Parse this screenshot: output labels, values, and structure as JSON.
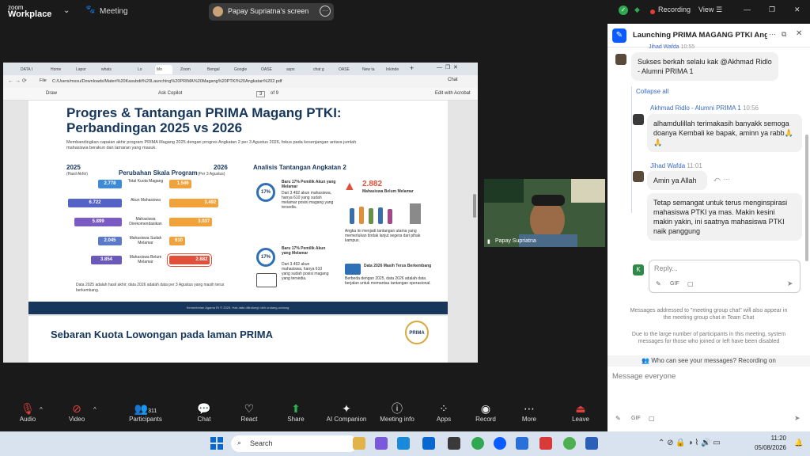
{
  "top": {
    "app_line1": "zoom",
    "app_line2": "Workplace",
    "meeting_label": "Meeting",
    "share_label": "Papay Supriatna's screen",
    "recording_label": "Recording",
    "view_label": "View"
  },
  "browser": {
    "tabs": [
      "DATA I",
      "Home",
      "Lapor",
      "whats",
      "Lo",
      "Mo",
      "Zoom",
      "Bengal",
      "Google",
      "OASE",
      "aspx",
      "chat g",
      "OASE",
      "New ta",
      "Inkinde"
    ],
    "url_prefix": "File",
    "url": "C:/Users/mssu/Downloads/Materi%20Kasubdit%20Launching%20PRIMA%20Magang%20PTKI%20Angkatan%202.pdf",
    "chat_btn": "Chat",
    "draw": "Draw",
    "ask_copilot": "Ask Copilot",
    "page_num": "3",
    "page_of": "of 9",
    "edit_acrobat": "Edit with Acrobat"
  },
  "slide": {
    "title": "Progres & Tantangan PRIMA Magang PTKI: Perbandingan 2025 vs 2026",
    "subtitle": "Membandingkan capaian akhir program PRIMA Magang 2025 dengan progres Angkatan 2 per 3 Agustus 2026, fokus pada kesenjangan antara jumlah mahasiswa berakun dan lamaran yang masuk.",
    "left_year": "2025",
    "left_year_sub": "(Hasil Akhir)",
    "center_heading": "Perubahan Skala Program",
    "right_year": "2026",
    "right_year_sub": "(Per 3 Agustus)",
    "rows": [
      {
        "label": "Total Kuota Magang",
        "v2025": "2.778",
        "v2026": "1.546"
      },
      {
        "label": "Akun Mahasiswa",
        "v2025": "6.722",
        "v2026": "3.492"
      },
      {
        "label": "Mahasiswa Direkomendasikan",
        "v2025": "5.899",
        "v2026": "3.037"
      },
      {
        "label": "Mahasiswa Sudah Melamar",
        "v2025": "2.045",
        "v2026": "610"
      },
      {
        "label": "Mahasiswa Belum Melamar",
        "v2025": "3.854",
        "v2026": "2.882"
      }
    ],
    "left_note": "Data 2025 adalah hasil akhir; data 2026 adalah data per 3 Agustus yang masih terus berkembang.",
    "analysis_heading": "Analisis Tantangan Angkatan 2",
    "a1_pct": "17%",
    "a1_title": "Baru 17% Pemilik Akun yang Melamar",
    "a1_text": "Dari 3.492 akun mahasiswa, hanya 610 yang sudah melamar posisi magang yang tersedia.",
    "a2_num": "2.882",
    "a2_title": "Mahasiswa Belum Melamar",
    "a2_text": "Angka ini menjadi tantangan utama yang memerlukan tindak lanjut segera dari pihak kampus.",
    "a3_pct": "17%",
    "a3_title": "Baru 17% Pemilik Akun yang Melamar",
    "a3_text": "Dari 3.492 akun mahasiswa, hanya 610 yang sudah posisi magang yang tersedia.",
    "a4_title": "Data 2026 Masih Terus Berkembang",
    "a4_text": "Berbeda dengan 2025, data 2026 adalah data berjalan untuk memantau tantangan operasional.",
    "footer": "Kementerian Agama RI © 2025. Hak data dilindungi oleh undang-undang.",
    "next_title": "Sebaran Kuota Lowongan pada laman PRIMA",
    "logo_text": "PRIMA"
  },
  "video": {
    "name": "Papay Supriatna"
  },
  "chat": {
    "title": "Launching PRIMA MAGANG PTKI Angk...",
    "partial_sender": "Jihad Wafda",
    "partial_time": "10:55",
    "m1": "Sukses berkah selalu kak @Akhmad Ridlo - Alumni PRIMA 1",
    "collapse": "Collapse all",
    "s2": "Akhmad Ridlo - Alumni PRIMA 1",
    "s2_time": "10:56",
    "m2": "alhamdulillah terimakasih banyakk semoga doanya Kembali ke bapak, aminn  ya rabb🙏🙏",
    "s3": "Jihad Wafda",
    "s3_time": "11:01",
    "m3": "Amin ya Allah",
    "m4": "Tetap semangat untuk terus menginspirasi mahasiswa PTKI ya mas. Makin kesini makin yakin, ini saatnya mahasiswa PTKI naik panggung",
    "reply_placeholder": "Reply...",
    "gif": "GIF",
    "notice1": "Messages addressed to \"meeting group chat\" will also appear in the meeting group chat in Team Chat",
    "notice2": "Due to the large number of participants in this meeting, system messages for those who joined or left have been disabled",
    "who_can_see": "Who can see your messages? Recording on",
    "input_placeholder": "Message everyone"
  },
  "toolbar": {
    "audio": "Audio",
    "video": "Video",
    "participants": "Participants",
    "participant_count": "311",
    "chat": "Chat",
    "react": "React",
    "share": "Share",
    "ai": "AI Companion",
    "meeting_info": "Meeting info",
    "apps": "Apps",
    "record": "Record",
    "more": "More",
    "leave": "Leave"
  },
  "taskbar": {
    "search": "Search",
    "time": "11:20",
    "date": "05/08/2026"
  }
}
